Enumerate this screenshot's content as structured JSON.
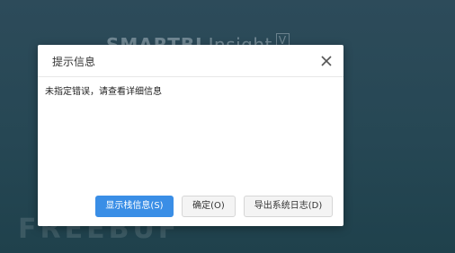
{
  "background": {
    "logo_brand": "SMARTBI",
    "logo_product": "Insight",
    "logo_mark": "V",
    "watermark": "FREEBUF"
  },
  "dialog": {
    "title": "提示信息",
    "close_icon": "close-icon",
    "message": "未指定错误，请查看详细信息",
    "buttons": {
      "show_stack": "显示栈信息(S)",
      "ok": "确定(O)",
      "export_log": "导出系统日志(D)"
    }
  },
  "colors": {
    "primary_button": "#3a8ee6",
    "background": "#264754"
  }
}
